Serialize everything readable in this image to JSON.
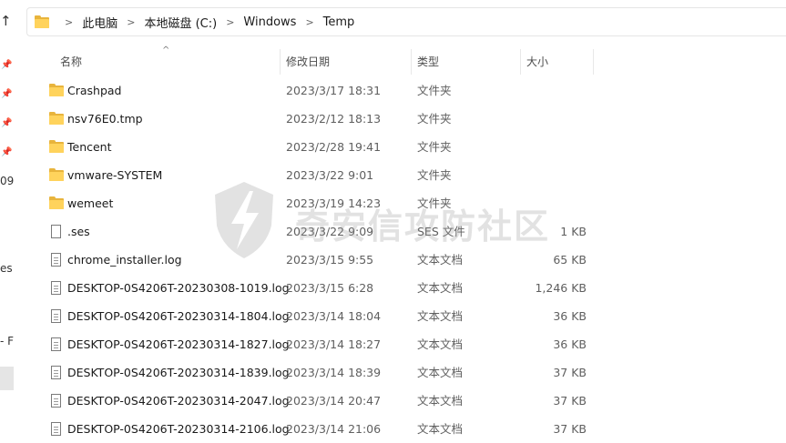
{
  "address_bar": {
    "crumbs": [
      "此电脑",
      "本地磁盘 (C:)",
      "Windows",
      "Temp"
    ]
  },
  "nav_fragments": {
    "t1": "09",
    "t2": "es",
    "t3": "- F"
  },
  "columns": {
    "name": "名称",
    "modified": "修改日期",
    "type": "类型",
    "size": "大小",
    "sort_indicator": "^"
  },
  "files": [
    {
      "icon": "folder-icon",
      "name": "Crashpad",
      "modified": "2023/3/17 18:31",
      "type": "文件夹",
      "size": ""
    },
    {
      "icon": "folder-icon",
      "name": "nsv76E0.tmp",
      "modified": "2023/2/12 18:13",
      "type": "文件夹",
      "size": ""
    },
    {
      "icon": "folder-icon",
      "name": "Tencent",
      "modified": "2023/2/28 19:41",
      "type": "文件夹",
      "size": ""
    },
    {
      "icon": "folder-icon",
      "name": "vmware-SYSTEM",
      "modified": "2023/3/22 9:01",
      "type": "文件夹",
      "size": ""
    },
    {
      "icon": "folder-icon",
      "name": "wemeet",
      "modified": "2023/3/19 14:23",
      "type": "文件夹",
      "size": ""
    },
    {
      "icon": "file-icon",
      "name": ".ses",
      "modified": "2023/3/22 9:09",
      "type": "SES 文件",
      "size": "1 KB"
    },
    {
      "icon": "text-file-icon",
      "name": "chrome_installer.log",
      "modified": "2023/3/15 9:55",
      "type": "文本文档",
      "size": "65 KB"
    },
    {
      "icon": "text-file-icon",
      "name": "DESKTOP-0S4206T-20230308-1019.log",
      "modified": "2023/3/15 6:28",
      "type": "文本文档",
      "size": "1,246 KB"
    },
    {
      "icon": "text-file-icon",
      "name": "DESKTOP-0S4206T-20230314-1804.log",
      "modified": "2023/3/14 18:04",
      "type": "文本文档",
      "size": "36 KB"
    },
    {
      "icon": "text-file-icon",
      "name": "DESKTOP-0S4206T-20230314-1827.log",
      "modified": "2023/3/14 18:27",
      "type": "文本文档",
      "size": "36 KB"
    },
    {
      "icon": "text-file-icon",
      "name": "DESKTOP-0S4206T-20230314-1839.log",
      "modified": "2023/3/14 18:39",
      "type": "文本文档",
      "size": "37 KB"
    },
    {
      "icon": "text-file-icon",
      "name": "DESKTOP-0S4206T-20230314-2047.log",
      "modified": "2023/3/14 20:47",
      "type": "文本文档",
      "size": "37 KB"
    },
    {
      "icon": "text-file-icon",
      "name": "DESKTOP-0S4206T-20230314-2106.log",
      "modified": "2023/3/14 21:06",
      "type": "文本文档",
      "size": "37 KB"
    }
  ],
  "watermark": {
    "text": "奇安信攻防社区"
  },
  "colors": {
    "folder_front": "#ffd35c",
    "folder_back": "#e8b43c",
    "header_text": "#4d4d4d",
    "secondary_text": "#5f5f5f"
  }
}
